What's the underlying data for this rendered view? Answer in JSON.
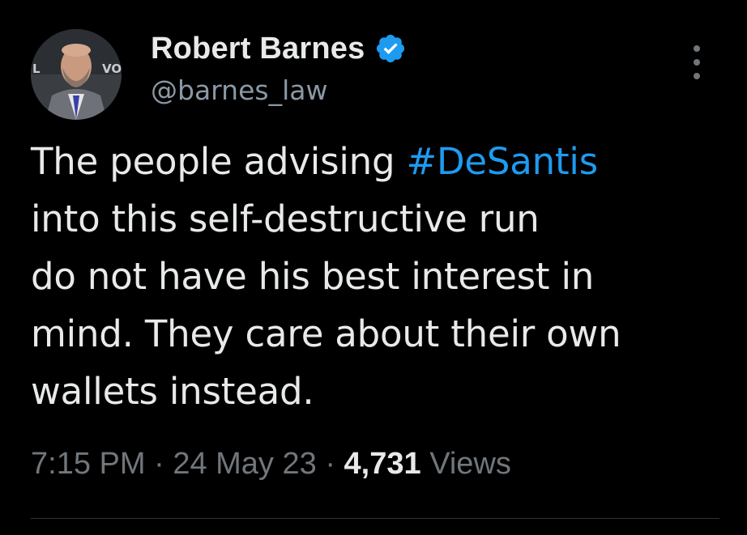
{
  "author": {
    "display_name": "Robert Barnes",
    "handle": "@barnes_law",
    "verified": true,
    "verified_icon": "verified-badge-icon",
    "avatar_icon": "profile-photo-avatar"
  },
  "tweet": {
    "text_lines": [
      {
        "before": "The people advising ",
        "hashtag": "#DeSantis"
      },
      {
        "text": "into this self-destructive run"
      },
      {
        "text": "do not have his best interest in"
      },
      {
        "text": "mind. They care about their own"
      },
      {
        "text": "wallets instead."
      }
    ]
  },
  "meta": {
    "time": "7:15 PM",
    "separator": "·",
    "date": "24 May 23",
    "views_count": "4,731",
    "views_label": "Views"
  },
  "more_icon": "more-options-icon",
  "colors": {
    "background": "#000000",
    "primary_text": "#e7e9ea",
    "secondary_text": "#71767b",
    "link": "#1d9bf0",
    "verified": "#1d9bf0"
  }
}
